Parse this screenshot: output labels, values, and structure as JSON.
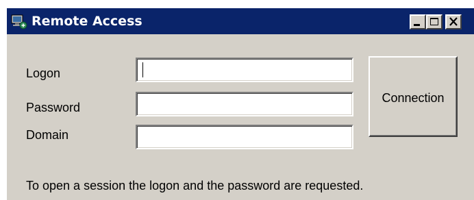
{
  "window": {
    "title": "Remote Access",
    "icon": "remote-access-computer-icon",
    "controls": {
      "minimize_icon": "minimize-icon",
      "maximize_icon": "maximize-icon",
      "close_icon": "close-icon"
    }
  },
  "form": {
    "logon": {
      "label": "Logon",
      "value": ""
    },
    "password": {
      "label": "Password",
      "value": ""
    },
    "domain": {
      "label": "Domain",
      "value": ""
    }
  },
  "actions": {
    "connection_label": "Connection"
  },
  "info_text": "To open a session the logon and the password are requested.",
  "colors": {
    "titlebar": "#0a246a",
    "window_bg": "#d4d0c8",
    "title_text": "#ffffff"
  }
}
